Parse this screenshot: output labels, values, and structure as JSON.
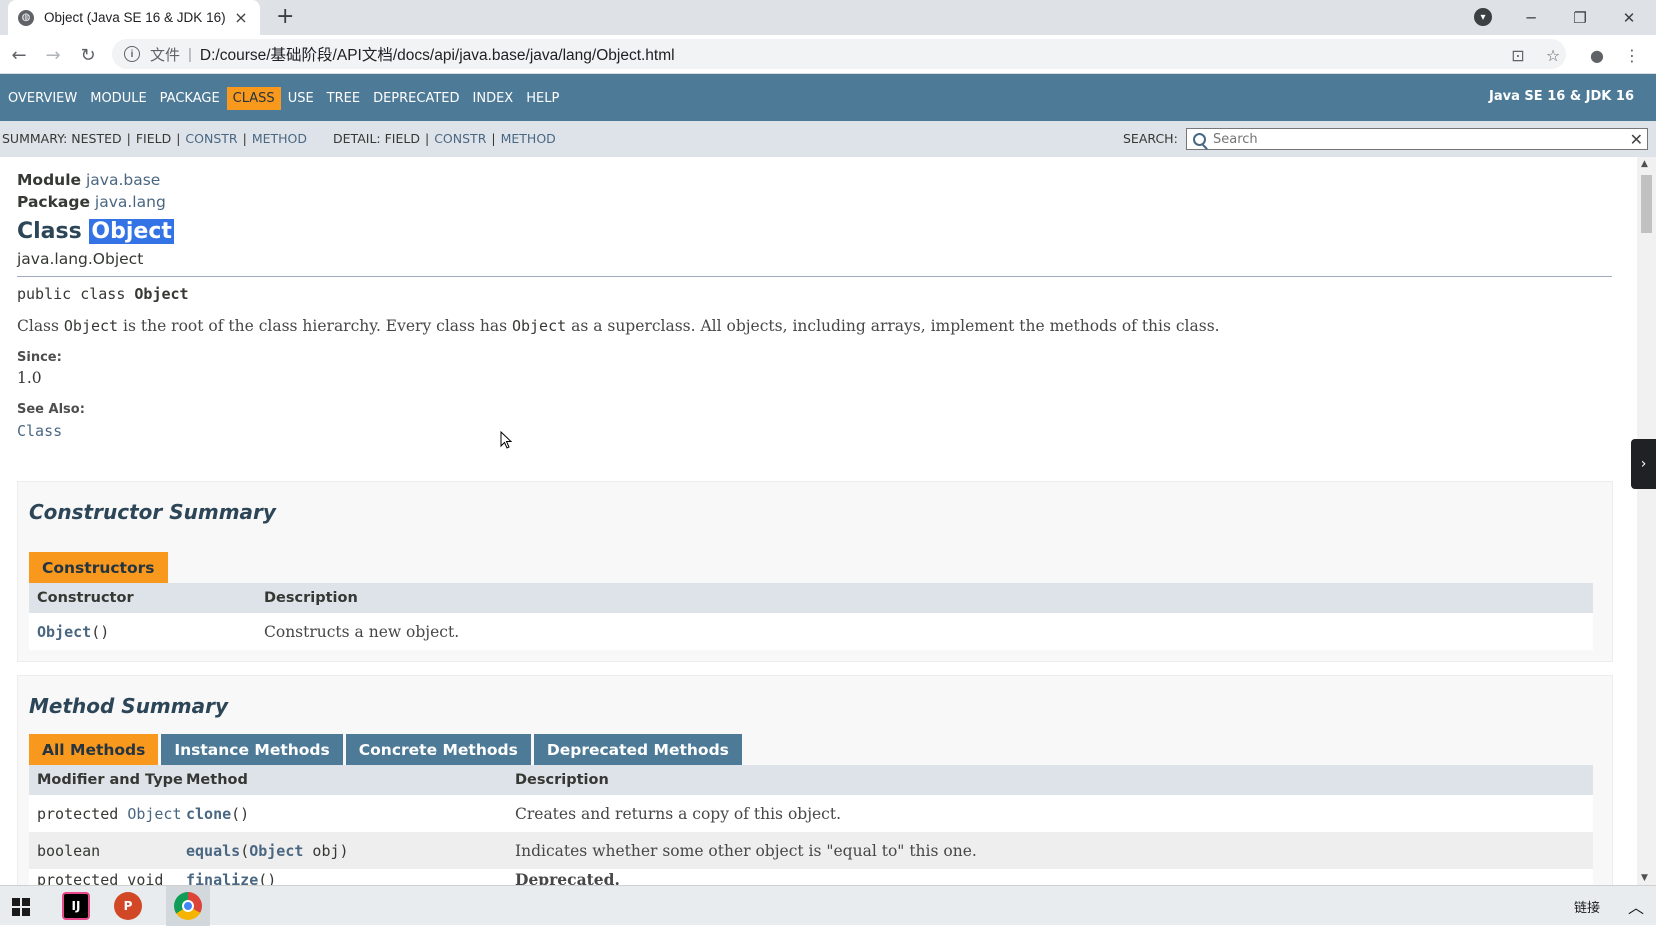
{
  "browser": {
    "tab_title": "Object (Java SE 16 & JDK 16)",
    "tab_close": "×",
    "new_tab": "+",
    "file_label": "文件",
    "url_separator": "|",
    "url": "D:/course/基础阶段/API文档/docs/api/java.base/java/lang/Object.html"
  },
  "nav": {
    "items": [
      "OVERVIEW",
      "MODULE",
      "PACKAGE",
      "CLASS",
      "USE",
      "TREE",
      "DEPRECATED",
      "INDEX",
      "HELP"
    ],
    "active": "CLASS",
    "about": "Java SE 16 & JDK 16"
  },
  "subnav": {
    "summary_label": "SUMMARY:",
    "summary_nested": "NESTED",
    "summary_field": "FIELD",
    "summary_constr": "CONSTR",
    "summary_method": "METHOD",
    "detail_label": "DETAIL:",
    "detail_field": "FIELD",
    "detail_constr": "CONSTR",
    "detail_method": "METHOD",
    "sep": "|",
    "search_label": "SEARCH:",
    "search_placeholder": "Search",
    "reset": "✕"
  },
  "header": {
    "module_label": "Module",
    "module_name": "java.base",
    "package_label": "Package",
    "package_name": "java.lang",
    "title_prefix": "Class",
    "title_name": "Object",
    "inheritance": "java.lang.Object"
  },
  "signature": {
    "modifiers": "public class ",
    "name": "Object"
  },
  "description": {
    "part1": "Class ",
    "code1": "Object",
    "part2": " is the root of the class hierarchy. Every class has ",
    "code2": "Object",
    "part3": " as a superclass. All objects, including arrays, implement the methods of this class."
  },
  "since": {
    "label": "Since:",
    "value": "1.0"
  },
  "see_also": {
    "label": "See Also:",
    "value": "Class"
  },
  "constructor_summary": {
    "heading": "Constructor Summary",
    "tab": "Constructors",
    "columns": [
      "Constructor",
      "Description"
    ],
    "rows": [
      {
        "name": "Object",
        "params": "()",
        "description": "Constructs a new object."
      }
    ]
  },
  "method_summary": {
    "heading": "Method Summary",
    "tabs": [
      "All Methods",
      "Instance Methods",
      "Concrete Methods",
      "Deprecated Methods"
    ],
    "active_tab": "All Methods",
    "columns": [
      "Modifier and Type",
      "Method",
      "Description"
    ],
    "rows": [
      {
        "modifier": "protected ",
        "type": "Object",
        "method": "clone",
        "params_pre": "()",
        "params_type": "",
        "params_post": "",
        "description": "Creates and returns a copy of this object."
      },
      {
        "modifier": "boolean",
        "type": "",
        "method": "equals",
        "params_pre": "(",
        "params_type": "Object",
        "params_post": " obj)",
        "description": "Indicates whether some other object is \"equal to\" this one."
      },
      {
        "modifier": "protected void",
        "type": "",
        "method": "finalize",
        "params_pre": "()",
        "params_type": "",
        "params_post": "",
        "description": "Deprecated."
      }
    ]
  },
  "taskbar": {
    "tray_text": "链接",
    "apps": [
      "IntelliJ IDEA",
      "PowerPoint",
      "Chrome"
    ]
  },
  "colors": {
    "nav_bg": "#4d7a97",
    "subnav_bg": "#dee3e9",
    "accent_orange": "#f8981d",
    "link": "#4a6782",
    "selection": "#3473e5"
  }
}
